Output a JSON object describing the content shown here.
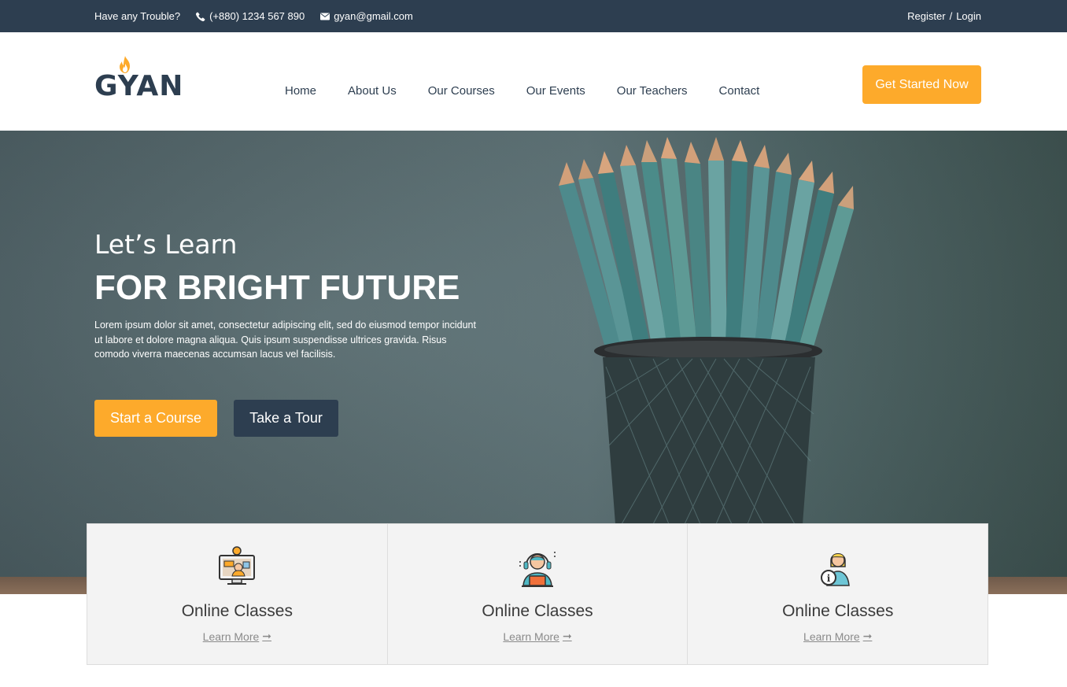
{
  "topbar": {
    "trouble": "Have any Trouble?",
    "phone": "(+880) 1234 567 890",
    "email": "gyan@gmail.com",
    "register": "Register",
    "separator": "/",
    "login": "Login",
    "icons": {
      "phone": "phone-icon",
      "email": "envelope-icon"
    }
  },
  "header": {
    "logo_text": "GYAN",
    "nav": [
      "Home",
      "About Us",
      "Our Courses",
      "Our Events",
      "Our Teachers",
      "Contact"
    ],
    "cta": "Get Started Now"
  },
  "hero": {
    "pretitle": "Let’s Learn",
    "title": "FOR BRIGHT FUTURE",
    "paragraph": "Lorem ipsum dolor sit amet, consectetur adipiscing elit, sed do eiusmod tempor incidunt ut labore et dolore magna aliqua. Quis ipsum suspendisse ultrices gravida. Risus comodo viverra maecenas accumsan lacus vel facilisis.",
    "btn_start": "Start a Course",
    "btn_tour": "Take a Tour"
  },
  "cards": [
    {
      "icon": "online-class-computer-icon",
      "title": "Online Classes",
      "link": "Learn More"
    },
    {
      "icon": "support-headset-icon",
      "title": "Online Classes",
      "link": "Learn More"
    },
    {
      "icon": "info-assistant-icon",
      "title": "Online Classes",
      "link": "Learn More"
    }
  ],
  "colors": {
    "dark": "#2d3e50",
    "accent": "#fdaa2b",
    "card_bg": "#f3f3f3"
  }
}
